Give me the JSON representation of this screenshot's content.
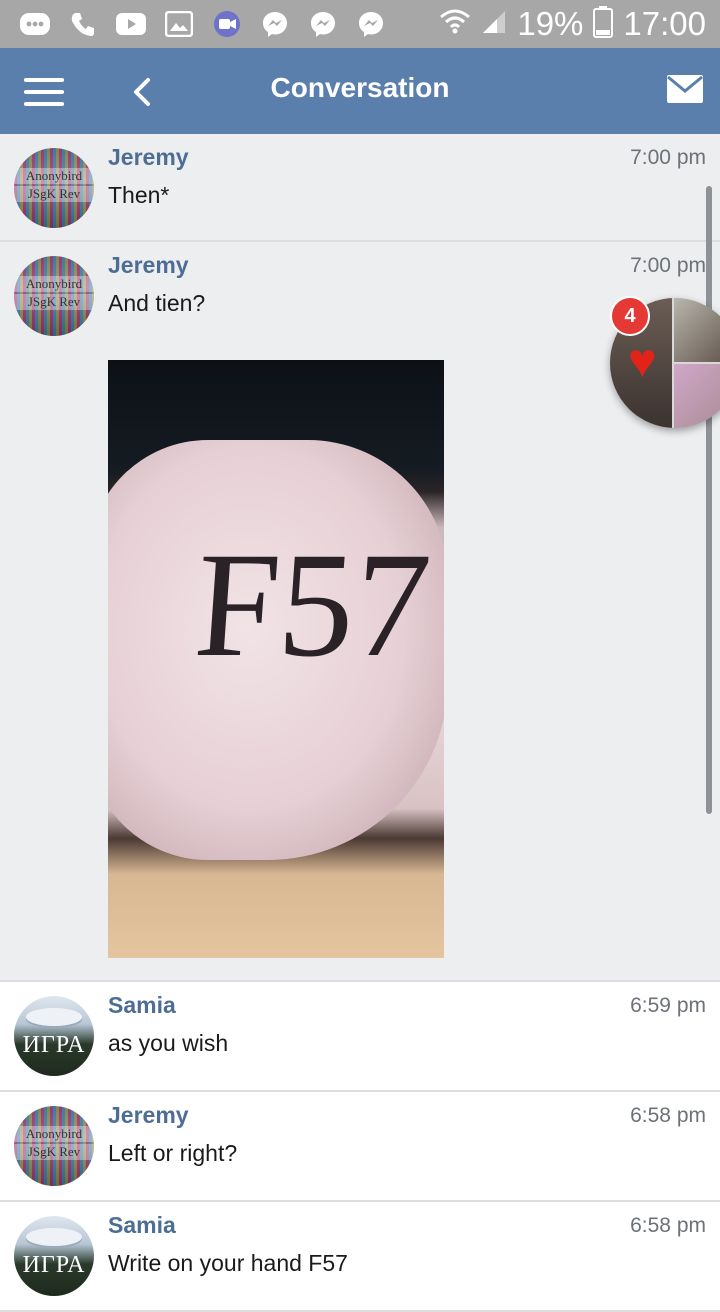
{
  "status_bar": {
    "battery": "19%",
    "time": "17:00",
    "icons": [
      "more-icon",
      "phone-icon",
      "youtube-icon",
      "gallery-icon",
      "video-icon",
      "messenger-icon",
      "messenger-icon",
      "messenger-icon",
      "wifi-icon",
      "signal-icon",
      "battery-icon"
    ]
  },
  "appbar": {
    "title": "Conversation"
  },
  "messages": [
    {
      "sender": "Jeremy",
      "time": "7:00 pm",
      "text": "Then*",
      "avatar_text": [
        "Anonybird",
        "JSgK Rev"
      ]
    },
    {
      "sender": "Jeremy",
      "time": "7:00 pm",
      "text": "And tien?",
      "avatar_text": [
        "Anonybird",
        "JSgK Rev"
      ],
      "photo_text": "F57"
    },
    {
      "sender": "Samia",
      "time": "6:59 pm",
      "text": "as you wish",
      "avatar_text": [
        "ИГРА"
      ]
    },
    {
      "sender": "Jeremy",
      "time": "6:58 pm",
      "text": "Left or right?",
      "avatar_text": [
        "Anonybird",
        "JSgK Rev"
      ]
    },
    {
      "sender": "Samia",
      "time": "6:58 pm",
      "text": "Write on your hand F57",
      "avatar_text": [
        "ИГРА"
      ]
    }
  ],
  "chat_head": {
    "badge": "4"
  },
  "colors": {
    "appbar": "#5b7fad",
    "name": "#4e6d94",
    "badge": "#e53935"
  }
}
